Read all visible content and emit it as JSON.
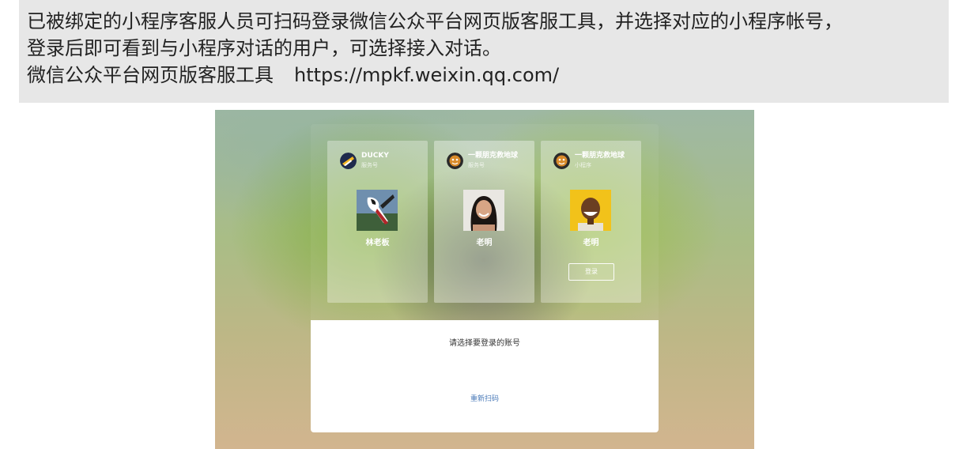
{
  "caption": {
    "line1": "已被绑定的小程序客服人员可扫码登录微信公众平台网页版客服工具，并选择对应的小程序帐号，",
    "line2": "登录后即可看到与小程序对话的用户，可选择接入对话。",
    "tool_name": "微信公众平台网页版客服工具",
    "tool_url": "https://mpkf.weixin.qq.com/"
  },
  "accounts": [
    {
      "account_name": "DUCKY",
      "account_type": "服务号",
      "user_name": "林老板",
      "avatar_icon": "ducky-logo-icon",
      "photo": "bird-photo"
    },
    {
      "account_name": "一颗朋克救地球",
      "account_type": "服务号",
      "user_name": "老明",
      "avatar_icon": "tiger-logo-icon",
      "photo": "woman-photo"
    },
    {
      "account_name": "一颗朋克救地球",
      "account_type": "小程序",
      "user_name": "老明",
      "avatar_icon": "tiger-logo-icon",
      "photo": "man-photo",
      "login_label": "登录"
    }
  ],
  "select_hint": "请选择要登录的账号",
  "rescan_label": "重新扫码",
  "colors": {
    "link": "#4a7ab8",
    "caption_bg": "#e7e7e7"
  }
}
